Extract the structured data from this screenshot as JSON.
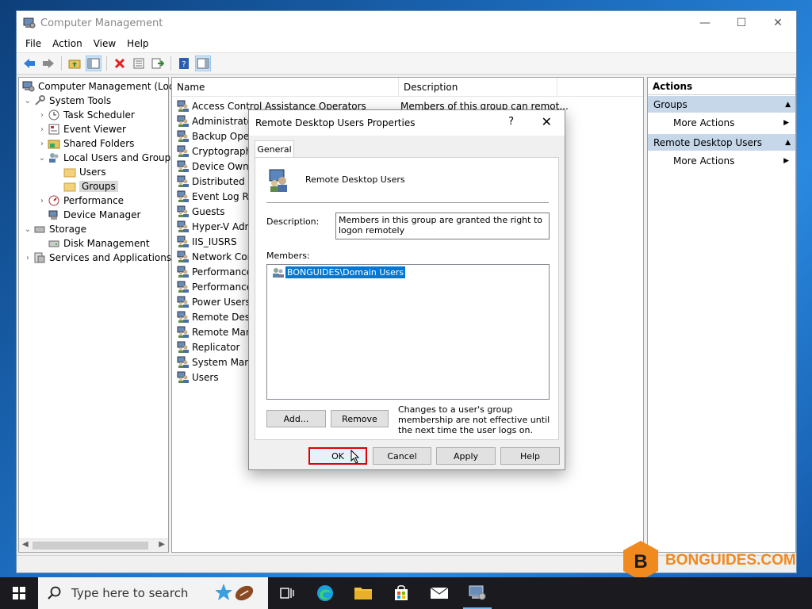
{
  "window": {
    "title": "Computer Management",
    "controls": {
      "minimize": "—",
      "maximize": "☐",
      "close": "✕"
    }
  },
  "menu": [
    "File",
    "Action",
    "View",
    "Help"
  ],
  "tree": {
    "root": "Computer Management (Local",
    "items": [
      {
        "label": "System Tools",
        "level": 1,
        "expander": "⌄"
      },
      {
        "label": "Task Scheduler",
        "level": 2,
        "expander": "›"
      },
      {
        "label": "Event Viewer",
        "level": 2,
        "expander": "›"
      },
      {
        "label": "Shared Folders",
        "level": 2,
        "expander": "›"
      },
      {
        "label": "Local Users and Groups",
        "level": 2,
        "expander": "⌄"
      },
      {
        "label": "Users",
        "level": 3,
        "expander": ""
      },
      {
        "label": "Groups",
        "level": 3,
        "expander": ""
      },
      {
        "label": "Performance",
        "level": 2,
        "expander": "›"
      },
      {
        "label": "Device Manager",
        "level": 2,
        "expander": ""
      },
      {
        "label": "Storage",
        "level": 1,
        "expander": "⌄"
      },
      {
        "label": "Disk Management",
        "level": 2,
        "expander": ""
      },
      {
        "label": "Services and Applications",
        "level": 1,
        "expander": "›"
      }
    ]
  },
  "list": {
    "columns": [
      "Name",
      "Description"
    ],
    "rows": [
      {
        "name": "Access Control Assistance Operators",
        "desc": "Members of this group can remot..."
      },
      {
        "name": "Administrators",
        "desc": ""
      },
      {
        "name": "Backup Operat",
        "desc": ""
      },
      {
        "name": "Cryptographic",
        "desc": ""
      },
      {
        "name": "Device Owners",
        "desc": ""
      },
      {
        "name": "Distributed CO",
        "desc": ""
      },
      {
        "name": "Event Log Rea",
        "desc": ""
      },
      {
        "name": "Guests",
        "desc": ""
      },
      {
        "name": "Hyper-V Admi",
        "desc": ""
      },
      {
        "name": "IIS_IUSRS",
        "desc": ""
      },
      {
        "name": "Network Confi",
        "desc": ""
      },
      {
        "name": "Performance L",
        "desc": ""
      },
      {
        "name": "Performance M",
        "desc": ""
      },
      {
        "name": "Power Users",
        "desc": ""
      },
      {
        "name": "Remote Deskto",
        "desc": ""
      },
      {
        "name": "Remote Mana",
        "desc": ""
      },
      {
        "name": "Replicator",
        "desc": ""
      },
      {
        "name": "System Manag",
        "desc": ""
      },
      {
        "name": "Users",
        "desc": ""
      }
    ]
  },
  "actions": {
    "title": "Actions",
    "groups": [
      {
        "label": "Groups",
        "item": "More Actions"
      },
      {
        "label": "Remote Desktop Users",
        "item": "More Actions"
      }
    ]
  },
  "dialog": {
    "title": "Remote Desktop Users Properties",
    "help_glyph": "?",
    "close_glyph": "✕",
    "tab": "General",
    "group_name": "Remote Desktop Users",
    "description_label": "Description:",
    "description_value": "Members in this group are granted the right to logon remotely",
    "members_label": "Members:",
    "members": [
      "BONGUIDES\\Domain Users"
    ],
    "add_label": "Add...",
    "remove_label": "Remove",
    "note": "Changes to a user's group membership are not effective until the next time the user logs on.",
    "ok_label": "OK",
    "cancel_label": "Cancel",
    "apply_label": "Apply",
    "help_label": "Help"
  },
  "taskbar": {
    "search_placeholder": "Type here to search"
  },
  "watermark": {
    "text": "BONGUIDES.COM",
    "logo_letter": "B"
  },
  "colors": {
    "accent": "#0078d7",
    "highlight_border": "#e00000",
    "actions_group_bg": "#c6d7ea",
    "watermark": "#f08a1e"
  }
}
